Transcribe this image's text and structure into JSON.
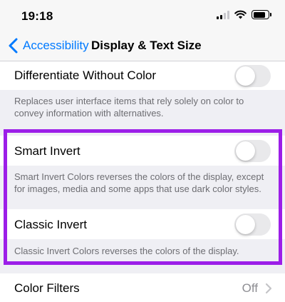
{
  "status_bar": {
    "time": "19:18"
  },
  "nav": {
    "back_label": "Accessibility",
    "title": "Display & Text Size"
  },
  "settings": [
    {
      "label": "Differentiate Without Color",
      "enabled": false,
      "footer": "Replaces user interface items that rely solely on color to convey information with alternatives."
    },
    {
      "label": "Smart Invert",
      "enabled": false,
      "footer": "Smart Invert Colors reverses the colors of the display, except for images, media and some apps that use dark color styles."
    },
    {
      "label": "Classic Invert",
      "enabled": false,
      "footer": "Classic Invert Colors reverses the colors of the display."
    }
  ],
  "color_filters": {
    "label": "Color Filters",
    "value": "Off"
  },
  "colors": {
    "accent": "#007aff",
    "highlight": "#9c1ee8",
    "toggle_off": "#e9e9eb"
  }
}
